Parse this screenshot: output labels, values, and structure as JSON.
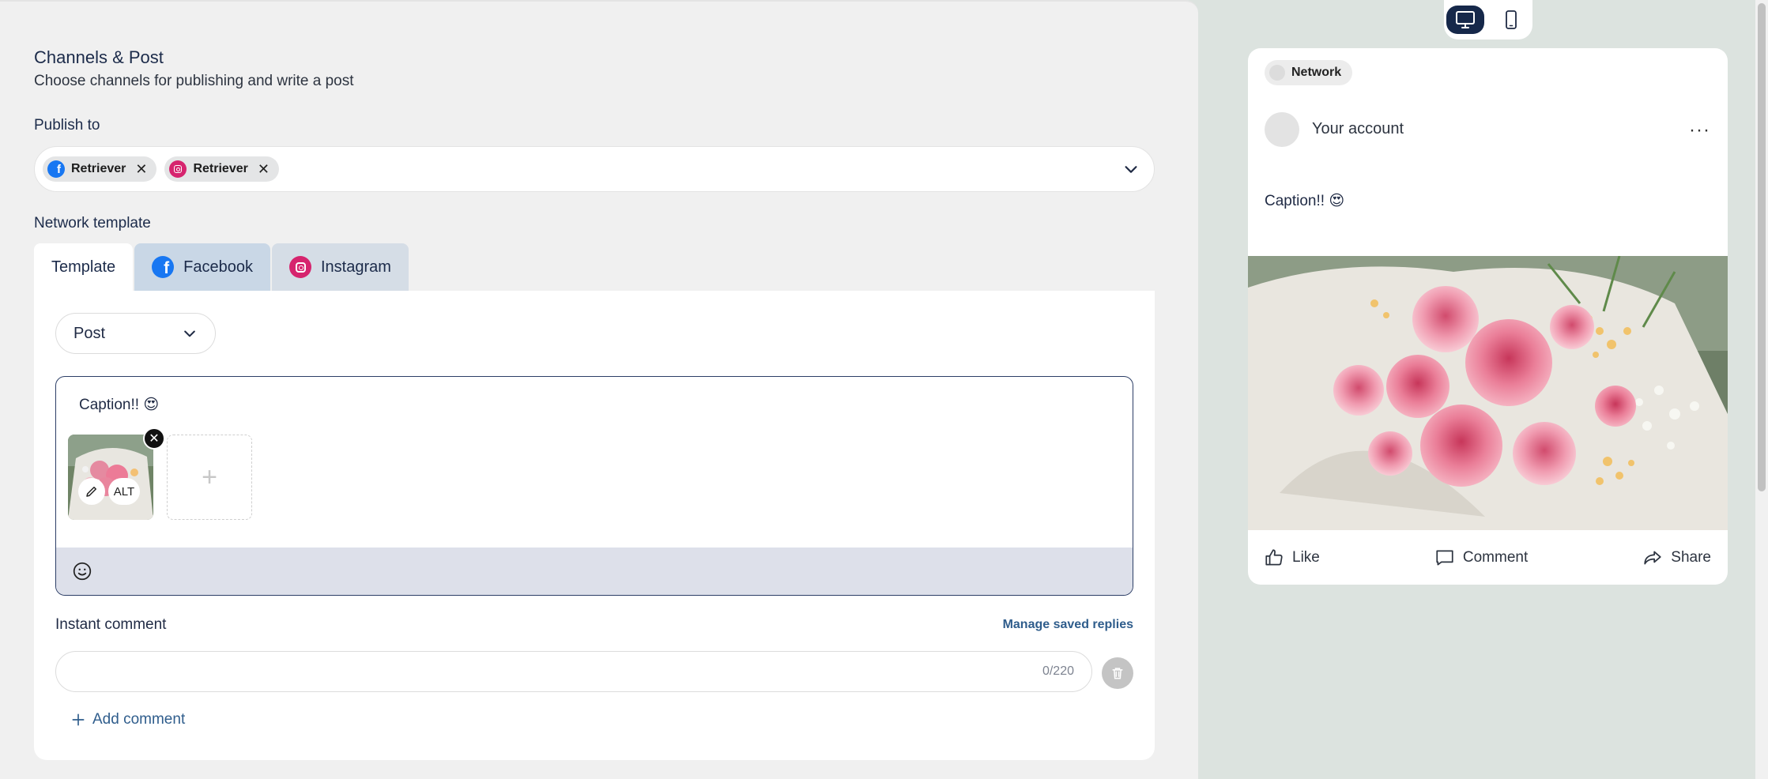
{
  "editor": {
    "title": "Channels & Post",
    "subtitle": "Choose channels for publishing and write a post",
    "publish_label": "Publish to",
    "channels": [
      {
        "name": "Retriever",
        "network": "facebook",
        "icon": "facebook-icon"
      },
      {
        "name": "Retriever",
        "network": "instagram",
        "icon": "instagram-icon"
      }
    ],
    "network_template_label": "Network template",
    "tabs": [
      {
        "label": "Template",
        "active": true
      },
      {
        "label": "Facebook",
        "icon": "facebook-icon"
      },
      {
        "label": "Instagram",
        "icon": "instagram-icon"
      }
    ],
    "post_type": "Post",
    "caption": "Caption!! 😍",
    "media": {
      "alt_label": "ALT",
      "add_label": "+"
    },
    "instant_comment_label": "Instant comment",
    "manage_replies_label": "Manage saved replies",
    "comment_counter": "0/220",
    "add_comment_label": "Add comment"
  },
  "preview": {
    "device_modes": [
      "desktop",
      "mobile"
    ],
    "active_device": "desktop",
    "network_label": "Network",
    "account_name": "Your account",
    "more_label": "···",
    "caption": "Caption!! 😍",
    "actions": [
      {
        "label": "Like",
        "icon": "thumbs-up-icon"
      },
      {
        "label": "Comment",
        "icon": "comment-icon"
      },
      {
        "label": "Share",
        "icon": "share-icon"
      }
    ]
  },
  "colors": {
    "accent_dark": "#16284a",
    "link": "#2f5d8c",
    "facebook": "#1877f2",
    "instagram": "#d6246e"
  }
}
